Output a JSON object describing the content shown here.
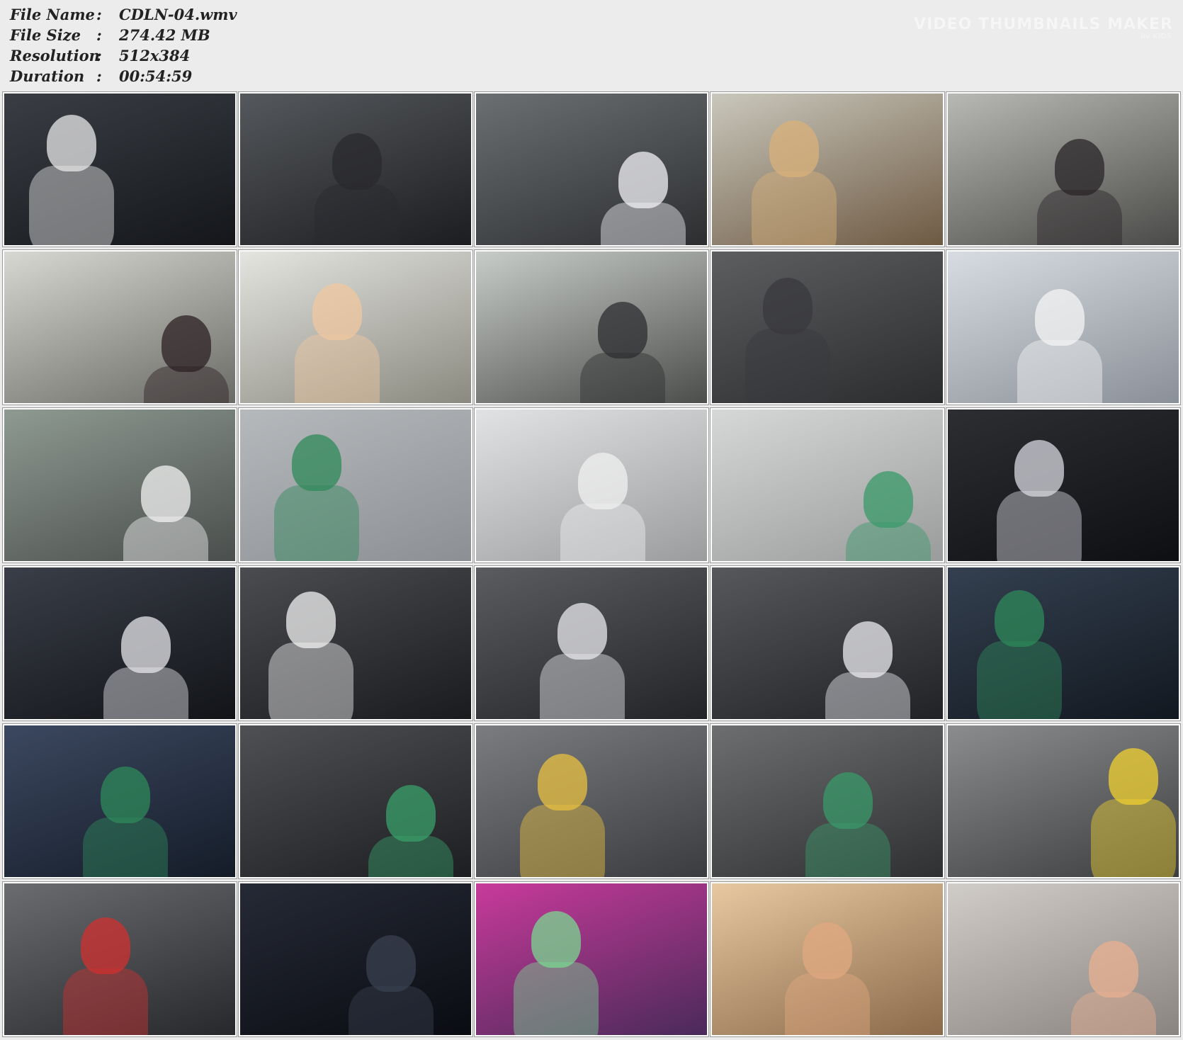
{
  "info": {
    "rows": [
      {
        "label": "File Name",
        "value": "CDLN-04.wmv"
      },
      {
        "label": "File Size",
        "value": "274.42 MB"
      },
      {
        "label": "Resolution",
        "value": "512x384"
      },
      {
        "label": "Duration",
        "value": "00:54:59"
      }
    ],
    "separator": ":"
  },
  "watermark": {
    "title": "VIDEO THUMBNAILS MAKER",
    "sub": "by KIDS"
  },
  "thumbnails": [
    {
      "icon": "video-frame-thumbnail",
      "bg": [
        "#3a3e44",
        "#14161a"
      ],
      "accent": "#e8e8e8"
    },
    {
      "icon": "video-frame-thumbnail",
      "bg": [
        "#55585c",
        "#1c1d20"
      ],
      "accent": "#2a2a2e"
    },
    {
      "icon": "video-frame-thumbnail",
      "bg": [
        "#6c6f72",
        "#2c2e30"
      ],
      "accent": "#f2f2f6"
    },
    {
      "icon": "video-frame-thumbnail",
      "bg": [
        "#c9c7bc",
        "#6e5a43"
      ],
      "accent": "#d9b27a"
    },
    {
      "icon": "video-frame-thumbnail",
      "bg": [
        "#b8b8b4",
        "#4a4a48"
      ],
      "accent": "#2a2628"
    },
    {
      "icon": "video-frame-thumbnail",
      "bg": [
        "#d8d8d2",
        "#6a6a66"
      ],
      "accent": "#2c2024"
    },
    {
      "icon": "video-frame-thumbnail",
      "bg": [
        "#e4e4e0",
        "#8a8a80"
      ],
      "accent": "#f0c8a0"
    },
    {
      "icon": "video-frame-thumbnail",
      "bg": [
        "#c8ccc8",
        "#4c4e4c"
      ],
      "accent": "#2e2e30"
    },
    {
      "icon": "video-frame-thumbnail",
      "bg": [
        "#5c5e60",
        "#2a2c2e"
      ],
      "accent": "#3a3a3e"
    },
    {
      "icon": "video-frame-thumbnail",
      "bg": [
        "#d8dce2",
        "#8a9098"
      ],
      "accent": "#f4f4f4"
    },
    {
      "icon": "video-frame-thumbnail",
      "bg": [
        "#8e9a92",
        "#4a4e4c"
      ],
      "accent": "#f2f2f2"
    },
    {
      "icon": "video-frame-thumbnail",
      "bg": [
        "#b6b9bc",
        "#8c9094"
      ],
      "accent": "#2f8a5a"
    },
    {
      "icon": "video-frame-thumbnail",
      "bg": [
        "#e0e2e4",
        "#9a9c9e"
      ],
      "accent": "#f0f0f0"
    },
    {
      "icon": "video-frame-thumbnail",
      "bg": [
        "#d6d8d8",
        "#9a9c9c"
      ],
      "accent": "#3a9a6a"
    },
    {
      "icon": "video-frame-thumbnail",
      "bg": [
        "#2c2e32",
        "#0e0f12"
      ],
      "accent": "#d8d8e0"
    },
    {
      "icon": "video-frame-thumbnail",
      "bg": [
        "#3a3e48",
        "#121418"
      ],
      "accent": "#e6e6ea"
    },
    {
      "icon": "video-frame-thumbnail",
      "bg": [
        "#4a4c50",
        "#1a1b1e"
      ],
      "accent": "#f2f2f2"
    },
    {
      "icon": "video-frame-thumbnail",
      "bg": [
        "#5a5c60",
        "#222428"
      ],
      "accent": "#e8e8ec"
    },
    {
      "icon": "video-frame-thumbnail",
      "bg": [
        "#56585c",
        "#202226"
      ],
      "accent": "#ececf0"
    },
    {
      "icon": "video-frame-thumbnail",
      "bg": [
        "#344050",
        "#121820"
      ],
      "accent": "#2e8a5a"
    },
    {
      "icon": "video-frame-thumbnail",
      "bg": [
        "#3c4860",
        "#141c28"
      ],
      "accent": "#2e8a5a"
    },
    {
      "icon": "video-frame-thumbnail",
      "bg": [
        "#4e5054",
        "#1c1e22"
      ],
      "accent": "#3aa06a"
    },
    {
      "icon": "video-frame-thumbnail",
      "bg": [
        "#7a7c80",
        "#3a3c40"
      ],
      "accent": "#e8c040"
    },
    {
      "icon": "video-frame-thumbnail",
      "bg": [
        "#6c6e70",
        "#2e3032"
      ],
      "accent": "#3a9a6a"
    },
    {
      "icon": "video-frame-thumbnail",
      "bg": [
        "#8a8c8e",
        "#3c3e40"
      ],
      "accent": "#f0d030"
    },
    {
      "icon": "video-frame-thumbnail",
      "bg": [
        "#6a6c70",
        "#26282c"
      ],
      "accent": "#d03030"
    },
    {
      "icon": "video-frame-thumbnail",
      "bg": [
        "#262a36",
        "#0a0c12"
      ],
      "accent": "#3a4050"
    },
    {
      "icon": "video-frame-thumbnail",
      "bg": [
        "#c83a9a",
        "#4a2a5a"
      ],
      "accent": "#7ad890"
    },
    {
      "icon": "video-frame-thumbnail",
      "bg": [
        "#e8c8a0",
        "#8a6a4a"
      ],
      "accent": "#e0a880"
    },
    {
      "icon": "video-frame-thumbnail",
      "bg": [
        "#d0ccc8",
        "#8a8480"
      ],
      "accent": "#e8b090"
    }
  ]
}
